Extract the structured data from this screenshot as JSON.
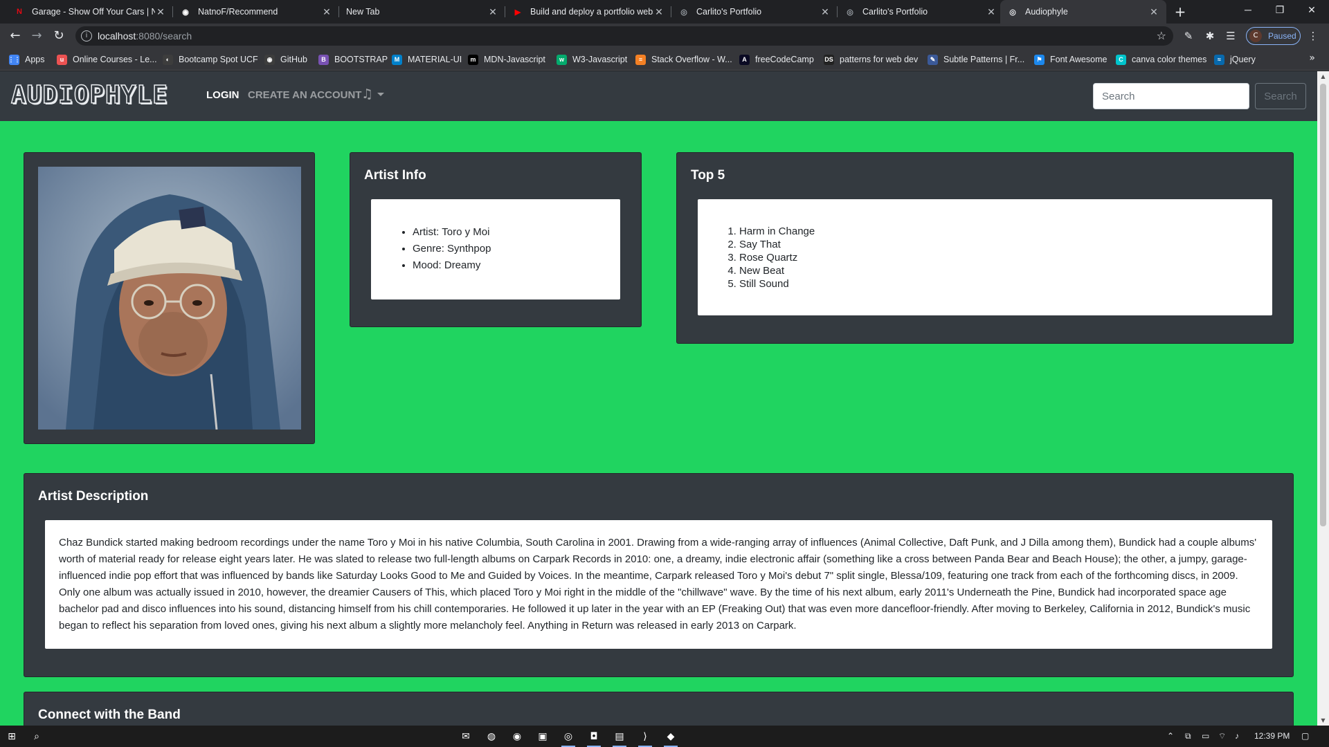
{
  "browser": {
    "tabs": [
      {
        "title": "Garage - Show Off Your Cars | Nationwide",
        "icon": "netflix-n-icon",
        "color": "#e50914",
        "glyph": "N"
      },
      {
        "title": "NatnoF/Recommend",
        "icon": "github-icon",
        "color": "#ffffff",
        "glyph": "◉"
      },
      {
        "title": "New Tab",
        "icon": "",
        "color": "#ffffff",
        "glyph": ""
      },
      {
        "title": "Build and deploy a portfolio website",
        "icon": "youtube-icon",
        "color": "#ff0000",
        "glyph": "▶"
      },
      {
        "title": "Carlito's Portfolio",
        "icon": "globe-icon",
        "color": "#9aa0a6",
        "glyph": "◎"
      },
      {
        "title": "Carlito's Portfolio",
        "icon": "globe-icon",
        "color": "#9aa0a6",
        "glyph": "◎"
      },
      {
        "title": "Audiophyle",
        "icon": "globe-icon",
        "color": "#e8eaed",
        "glyph": "◎"
      }
    ],
    "url_host": "localhost",
    "url_path": ":8080/search",
    "profile_initial": "C",
    "profile_status": "Paused",
    "bookmarks": [
      {
        "label": "Apps",
        "icon": "apps-grid-icon",
        "color": "#4285f4",
        "glyph": "⋮⋮"
      },
      {
        "label": "Online Courses - Le...",
        "icon": "udemy-icon",
        "color": "#ec5252",
        "glyph": "u"
      },
      {
        "label": "Bootcamp Spot UCF",
        "icon": "bootcamp-icon",
        "color": "#3d3d3d",
        "glyph": "◐"
      },
      {
        "label": "GitHub",
        "icon": "github-icon",
        "color": "#3d3d3d",
        "glyph": "◉"
      },
      {
        "label": "BOOTSTRAP",
        "icon": "bootstrap-icon",
        "color": "#7952b3",
        "glyph": "B"
      },
      {
        "label": "MATERIAL-UI",
        "icon": "material-ui-icon",
        "color": "#0081cb",
        "glyph": "M"
      },
      {
        "label": "MDN-Javascript",
        "icon": "mdn-icon",
        "color": "#000000",
        "glyph": "m"
      },
      {
        "label": "W3-Javascript",
        "icon": "w3schools-icon",
        "color": "#04aa6d",
        "glyph": "w"
      },
      {
        "label": "Stack Overflow - W...",
        "icon": "stackoverflow-icon",
        "color": "#f48024",
        "glyph": "≡"
      },
      {
        "label": "freeCodeCamp",
        "icon": "freecodecamp-icon",
        "color": "#0a0a23",
        "glyph": "A"
      },
      {
        "label": "patterns for web dev",
        "icon": "ds-icon",
        "color": "#222222",
        "glyph": "DS"
      },
      {
        "label": "Subtle Patterns | Fr...",
        "icon": "subtle-patterns-icon",
        "color": "#3b5998",
        "glyph": "✎"
      },
      {
        "label": "Font Awesome",
        "icon": "font-awesome-icon",
        "color": "#1c88ed",
        "glyph": "⚑"
      },
      {
        "label": "canva color themes",
        "icon": "canva-icon",
        "color": "#00c4cc",
        "glyph": "C"
      },
      {
        "label": "jQuery",
        "icon": "jquery-icon",
        "color": "#0769ad",
        "glyph": "≈"
      }
    ]
  },
  "site": {
    "brand": "AUDIOPHYLE",
    "nav_login": "LOGIN",
    "nav_create": "CREATE AN ACCOUNT",
    "search_placeholder": "Search",
    "search_button": "Search",
    "bg_color": "#20d460",
    "card_color": "#343a40"
  },
  "artist_info": {
    "heading": "Artist Info",
    "items": [
      "Artist: Toro y Moi",
      "Genre: Synthpop",
      "Mood: Dreamy"
    ]
  },
  "top5": {
    "heading": "Top 5",
    "tracks": [
      "Harm in Change",
      "Say That",
      "Rose Quartz",
      "New Beat",
      "Still Sound"
    ]
  },
  "description": {
    "heading": "Artist Description",
    "text": "Chaz Bundick started making bedroom recordings under the name Toro y Moi in his native Columbia, South Carolina in 2001. Drawing from a wide-ranging array of influences (Animal Collective, Daft Punk, and J Dilla among them), Bundick had a couple albums' worth of material ready for release eight years later. He was slated to release two full-length albums on Carpark Records in 2010: one, a dreamy, indie electronic affair (something like a cross between Panda Bear and Beach House); the other, a jumpy, garage-influenced indie pop effort that was influenced by bands like Saturday Looks Good to Me and Guided by Voices. In the meantime, Carpark released Toro y Moi's debut 7\" split single, Blessa/109, featuring one track from each of the forthcoming discs, in 2009. Only one album was actually issued in 2010, however, the dreamier Causers of This, which placed Toro y Moi right in the middle of the \"chillwave\" wave. By the time of his next album, early 2011's Underneath the Pine, Bundick had incorporated space age bachelor pad and disco influences into his sound, distancing himself from his chill contemporaries. He followed it up later in the year with an EP (Freaking Out) that was even more dancefloor-friendly. After moving to Berkeley, California in 2012, Bundick's music began to reflect his separation from loved ones, giving his next album a slightly more melancholy feel. Anything in Return was released in early 2013 on Carpark."
  },
  "connect": {
    "heading": "Connect with the Band"
  },
  "taskbar": {
    "time": "12:39 PM"
  }
}
